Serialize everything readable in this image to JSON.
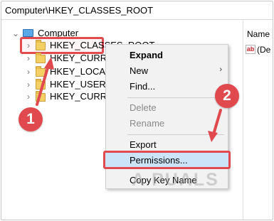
{
  "address_bar": {
    "path": "Computer\\HKEY_CLASSES_ROOT"
  },
  "tree": {
    "root": {
      "label": "Computer",
      "expander": "⌄",
      "icon": "computer-icon"
    },
    "items": [
      {
        "label": "HKEY_CLASSES_ROOT",
        "expander": "›",
        "icon": "folder-icon",
        "highlighted": true
      },
      {
        "label": "HKEY_CURREN",
        "expander": "›",
        "icon": "folder-icon"
      },
      {
        "label": "HKEY_LOCAL_M",
        "expander": "›",
        "icon": "folder-icon"
      },
      {
        "label": "HKEY_USERS",
        "expander": "›",
        "icon": "folder-icon"
      },
      {
        "label": "HKEY_CURREN",
        "expander": "›",
        "icon": "folder-icon"
      }
    ]
  },
  "right_pane": {
    "column_header": "Name",
    "default_icon_text": "ab",
    "default_value": "(De"
  },
  "context_menu": {
    "items": [
      {
        "label": "Expand",
        "bold": true
      },
      {
        "label": "New",
        "submenu": "›"
      },
      {
        "label": "Find..."
      },
      {
        "label": "Delete",
        "disabled": true
      },
      {
        "label": "Rename",
        "disabled": true
      },
      {
        "label": "Export"
      },
      {
        "label": "Permissions...",
        "highlighted": true
      },
      {
        "label": "Copy Key Name"
      }
    ]
  },
  "annotations": {
    "step1": "1",
    "step2": "2",
    "accent_color": "#e04a4f"
  },
  "watermark": "A  PUALS"
}
